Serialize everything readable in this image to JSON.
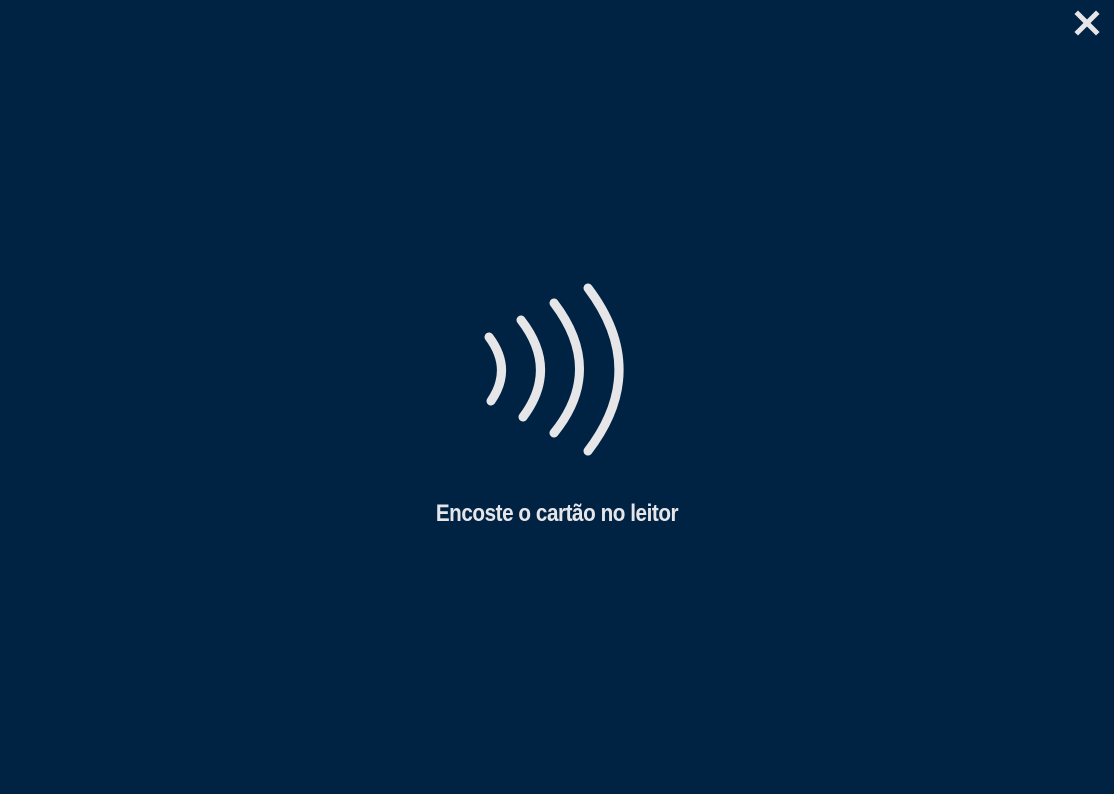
{
  "screen": {
    "background_color": "#002344",
    "foreground_color": "#e6e6e9"
  },
  "close_button": {
    "icon": "close-icon"
  },
  "contactless": {
    "icon": "contactless-icon"
  },
  "instruction": {
    "text": "Encoste o cartão no leitor"
  }
}
